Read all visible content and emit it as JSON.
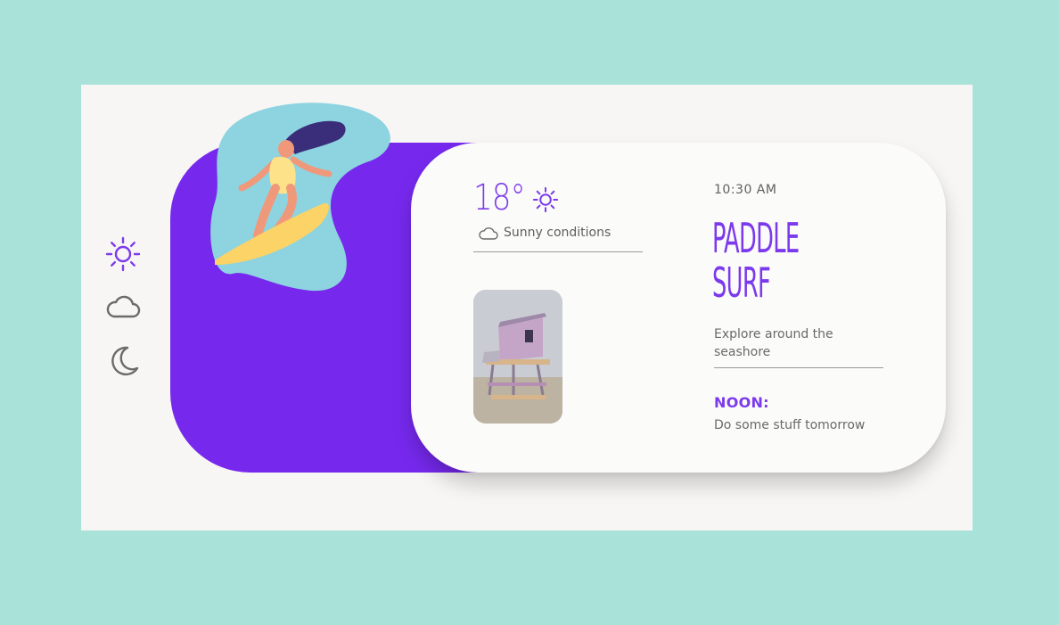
{
  "sidebar": {
    "items": [
      {
        "icon": "sun-icon",
        "active": true
      },
      {
        "icon": "cloud-icon",
        "active": false
      },
      {
        "icon": "moon-icon",
        "active": false
      }
    ]
  },
  "weather": {
    "temperature": "18°",
    "condition_icon": "sun-icon",
    "conditions_text": "Sunny conditions",
    "conditions_icon": "cloud-icon"
  },
  "activity": {
    "time": "10:30 AM",
    "title_line1": "PADDLE",
    "title_line2": "SURF",
    "description": "Explore around the seashore",
    "noon_label": "NOON:",
    "noon_text": "Do some stuff tomorrow"
  },
  "colors": {
    "background": "#a8e2d9",
    "accent": "#7629ed",
    "card": "#fbfbf9",
    "text_muted": "#6a6a6a"
  }
}
